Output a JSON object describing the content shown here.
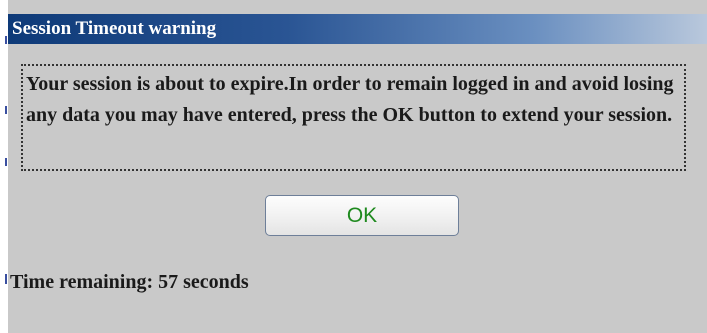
{
  "dialog": {
    "title": "Session Timeout warning",
    "message": "Your session is about to expire.In order to remain logged in and avoid losing any data you may have entered, press the OK button to extend your session.",
    "ok_label": "OK",
    "time_remaining": "Time remaining: 57 seconds"
  },
  "colors": {
    "dialog_background": "#c9c9c9",
    "titlebar_start": "#0e3a78",
    "titlebar_end": "#b9c8dc",
    "ok_text": "#1f8a1f"
  }
}
